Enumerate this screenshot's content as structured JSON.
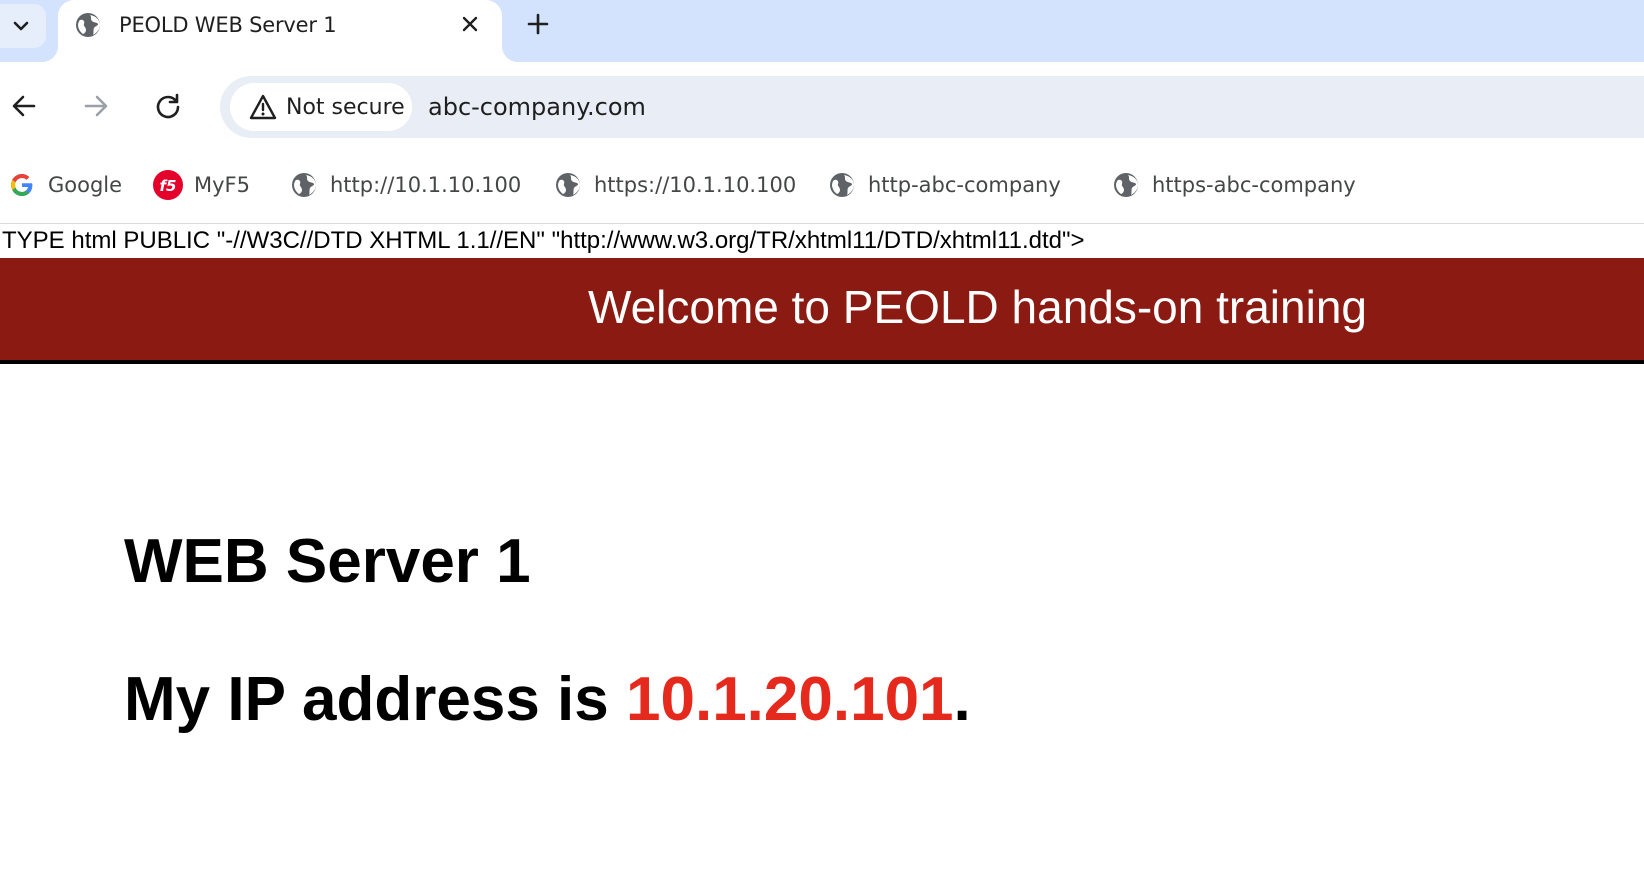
{
  "tab": {
    "title": "PEOLD WEB Server 1",
    "close_label": "×",
    "new_tab_label": "+"
  },
  "toolbar": {
    "security_chip": "Not secure",
    "url": "abc-company.com"
  },
  "bookmarks": [
    {
      "label": "Google",
      "icon": "google-icon"
    },
    {
      "label": "MyF5",
      "icon": "f5-icon"
    },
    {
      "label": "http://10.1.10.100",
      "icon": "globe-icon"
    },
    {
      "label": "https://10.1.10.100",
      "icon": "globe-icon"
    },
    {
      "label": "http-abc-company",
      "icon": "globe-icon"
    },
    {
      "label": "https-abc-company",
      "icon": "globe-icon"
    }
  ],
  "page": {
    "doctype_text": "TYPE html PUBLIC \"-//W3C//DTD XHTML 1.1//EN\" \"http://www.w3.org/TR/xhtml11/DTD/xhtml11.dtd\">",
    "banner": "Welcome to PEOLD hands-on training",
    "server_name": "WEB Server 1",
    "ip_prefix": "My IP address is ",
    "ip_value": "10.1.20.101",
    "ip_suffix": "."
  },
  "colors": {
    "tabstrip": "#d3e3fd",
    "banner": "#8b1a13",
    "ip_value": "#e52a1d"
  }
}
